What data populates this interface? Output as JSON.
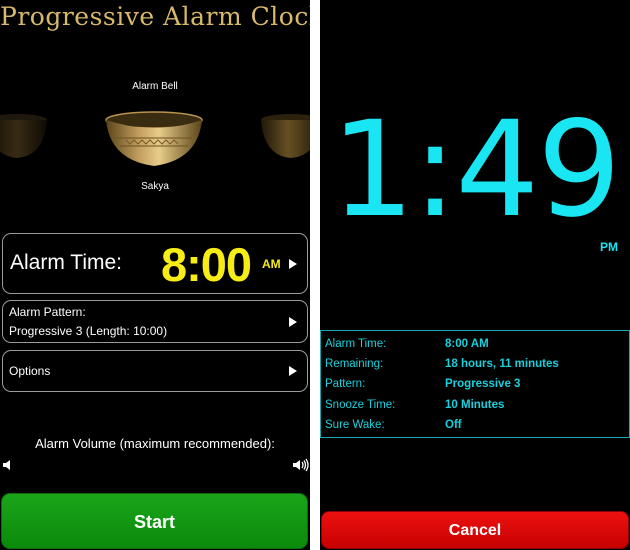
{
  "left_screen": {
    "app_title": "Progressive Alarm Clock",
    "bell_picker": {
      "category": "Alarm Bell",
      "selected_name": "Sakya"
    },
    "alarm_time": {
      "label": "Alarm Time:",
      "value": "8:00",
      "ampm": "AM"
    },
    "alarm_pattern": {
      "label": "Alarm Pattern:",
      "value": "Progressive 3 (Length: 10:00)"
    },
    "options": {
      "label": "Options"
    },
    "volume": {
      "label": "Alarm Volume (maximum recommended):",
      "level": 1.0
    },
    "start_label": "Start"
  },
  "right_screen": {
    "clock": {
      "time": "1:49",
      "ampm": "PM"
    },
    "status": [
      {
        "label": "Alarm Time:",
        "value": "8:00 AM"
      },
      {
        "label": "Remaining:",
        "value": "18 hours, 11 minutes"
      },
      {
        "label": "Pattern:",
        "value": "Progressive 3"
      },
      {
        "label": "Snooze Time:",
        "value": "10 Minutes"
      },
      {
        "label": "Sure Wake:",
        "value": "Off"
      }
    ],
    "cancel_label": "Cancel"
  },
  "colors": {
    "title_gold": "#d8b86a",
    "alarm_yellow": "#f8ec16",
    "clock_cyan": "#19e6f2",
    "start_green": "#0b8a0b",
    "cancel_red": "#e00000"
  },
  "icons": {
    "arrow": "disclosure-arrow-icon",
    "volume_min": "speaker-low-icon",
    "volume_max": "speaker-high-icon"
  }
}
